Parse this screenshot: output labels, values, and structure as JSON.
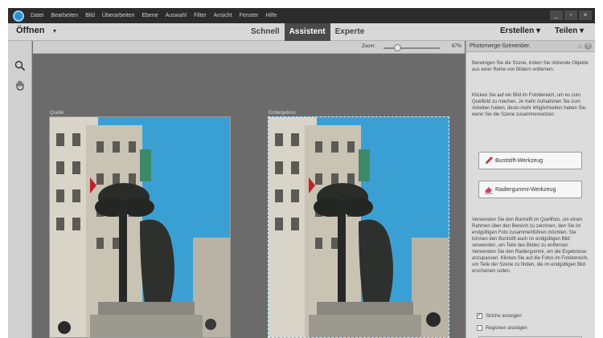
{
  "menu": {
    "items": [
      "Datei",
      "Bearbeiten",
      "Bild",
      "Überarbeiten",
      "Ebene",
      "Auswahl",
      "Filter",
      "Ansicht",
      "Fenster",
      "Hilfe"
    ],
    "window_buttons": [
      "_",
      "▫",
      "×"
    ]
  },
  "modebar": {
    "open_label": "Öffnen",
    "open_arrow": "▾",
    "tabs": [
      {
        "label": "Schnell",
        "active": false
      },
      {
        "label": "Assistent",
        "active": true
      },
      {
        "label": "Experte",
        "active": false
      }
    ],
    "create_label": "Erstellen ▾",
    "share_label": "Teilen ▾"
  },
  "tools": [
    {
      "name": "zoom-tool",
      "icon": "magnifier-icon"
    },
    {
      "name": "hand-tool",
      "icon": "hand-icon"
    }
  ],
  "canvas": {
    "zoom_label": "Zoom:",
    "zoom_value": "67%",
    "zoom_fraction": 0.25,
    "source_label": "Quelle",
    "result_label": "Endergebnis"
  },
  "panel": {
    "title": "Photomerge-Szenenber.",
    "intro": "Bereinigen Sie die Szene, indem Sie störende Objekte aus einer Reihe von Bildern entfernen.",
    "instructions": "Klicken Sie auf ein Bild im Fotobereich, um es zum Quellbild zu machen. Je mehr Aufnahmen Sie zum Arbeiten haben, desto mehr Möglichkeiten haben Sie, wenn Sie die Szene zusammensetzen.",
    "pencil_button": "Buntstift-Werkzeug",
    "eraser_button": "Radiergummi-Werkzeug",
    "help_text": "Verwenden Sie den Buntstift im Quellfoto, um einen Rahmen über den Bereich zu zeichnen, den Sie im endgültigen Foto zusammenführen möchten. Sie können den Buntstift auch im endgültigen Bild verwenden, um Teile des Bildes zu entfernen. Verwenden Sie den Radiergummi, um die Ergebnisse anzupassen. Klicken Sie auf die Fotos im Fotobereich, um Teile der Szene zu finden, die im endgültigen Bild erscheinen sollen.",
    "show_strokes": {
      "label": "Striche anzeigen",
      "checked": true
    },
    "show_regions": {
      "label": "Regionen anzeigen",
      "checked": false
    }
  },
  "colors": {
    "menubar": "#2c2c2c",
    "active_tab": "#4a4a4a",
    "canvas": "#6b6b6b",
    "accent": "#2a7fc0"
  }
}
